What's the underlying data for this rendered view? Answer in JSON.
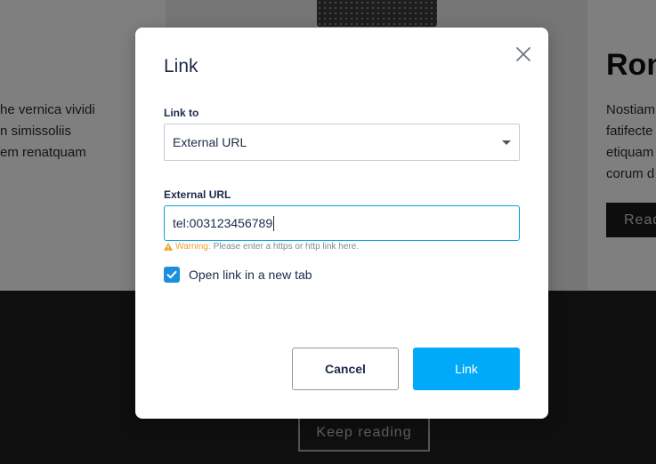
{
  "background": {
    "left_text_lines": [
      "he vernica vividi",
      "n simissoliis",
      "em renatquam"
    ],
    "right_heading": "Ron",
    "right_text_lines": [
      "Nostiam",
      "fatifecte",
      "etiquam",
      "corum d"
    ],
    "right_button": "Read",
    "keep_reading": "Keep reading"
  },
  "modal": {
    "title": "Link",
    "link_to_label": "Link to",
    "link_to_value": "External URL",
    "url_label": "External URL",
    "url_value": "tel:003123456789",
    "warning_label": "Warning:",
    "warning_text": "Please enter a https or http link here.",
    "open_new_tab_label": "Open link in a new tab",
    "open_new_tab_checked": true,
    "cancel_label": "Cancel",
    "link_label": "Link"
  },
  "colors": {
    "accent": "#00aaf8",
    "checkbox": "#1a8fe0",
    "warning": "#f0a02a",
    "text": "#1b2a4a"
  }
}
